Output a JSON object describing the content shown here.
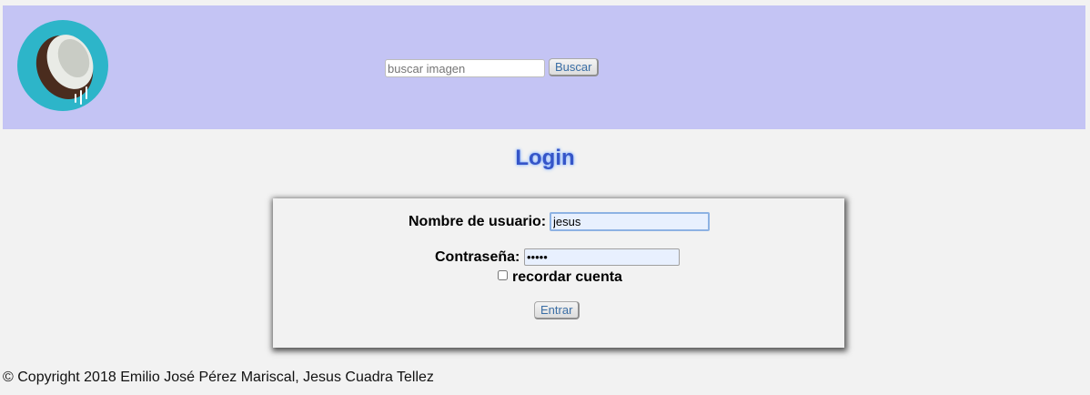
{
  "header": {
    "logo_icon": "coconut-logo-icon",
    "search": {
      "placeholder": "buscar imagen",
      "value": "",
      "button_label": "Buscar"
    }
  },
  "main": {
    "title": "Login",
    "form": {
      "username_label": "Nombre de usuario:",
      "username_value": "jesus",
      "password_label": "Contraseña:",
      "password_value": "•••••",
      "remember_label": "recordar cuenta",
      "remember_checked": false,
      "submit_label": "Entrar"
    }
  },
  "footer": {
    "copyright": "© Copyright 2018 Emilio José Pérez Mariscal, Jesus Cuadra Tellez"
  },
  "colors": {
    "header_bg": "#c4c4f4",
    "page_bg": "#f2f2f2",
    "title": "#3555c8",
    "logo_circle": "#2db5c9"
  }
}
